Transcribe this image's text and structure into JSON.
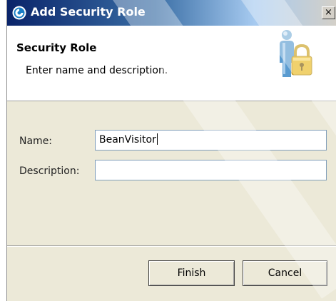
{
  "window": {
    "title": "Add Security Role",
    "close_label": "×"
  },
  "header": {
    "title": "Security Role",
    "description": "Enter name and description."
  },
  "form": {
    "name_label": "Name:",
    "name_value": "BeanVisitor",
    "description_label": "Description:",
    "description_value": ""
  },
  "buttons": {
    "finish_label": "Finish",
    "cancel_label": "Cancel"
  },
  "icons": {
    "title_icon": "eclipse-app-icon",
    "header_icon": "user-lock-icon"
  },
  "colors": {
    "titlebar_start": "#0a246a",
    "titlebar_end": "#d4d0c8",
    "dialog_bg": "#ece9d8",
    "field_border": "#7f9db9",
    "lock_gold": "#e8b820"
  }
}
